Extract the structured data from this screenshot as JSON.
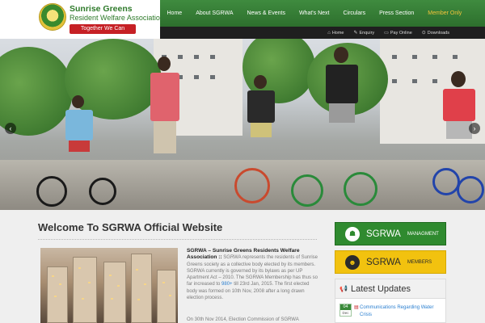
{
  "logo": {
    "title": "Sunrise Greens",
    "subtitle": "Resident Welfare Association",
    "tagline": "Together We Can"
  },
  "nav": {
    "items": [
      {
        "label": "Home"
      },
      {
        "label": "About SGRWA"
      },
      {
        "label": "News & Events"
      },
      {
        "label": "What's Next"
      },
      {
        "label": "Circulars"
      },
      {
        "label": "Press Section"
      },
      {
        "label": "Member Only"
      }
    ],
    "highlight_color": "#f3c33a"
  },
  "util": {
    "items": [
      {
        "label": "Home",
        "icon": "home-icon"
      },
      {
        "label": "Enquiry",
        "icon": "pencil-icon"
      },
      {
        "label": "Pay Online",
        "icon": "card-icon"
      },
      {
        "label": "Downloads",
        "icon": "download-icon"
      }
    ]
  },
  "welcome": {
    "heading": "Welcome To SGRWA Official Website"
  },
  "intro": {
    "title": "SGRWA – Sunrise Greens Residents Welfare Association ::",
    "text_a": " SGRWA represents the residents of Sunrise Greens society as a collective body elected by its members. SGRWA currently is governed by its bylaws as per UP Apartment Act – 2010. The SGRWA Membership has thus so far increased to ",
    "highlight": "980+",
    "text_b": " till 23rd Jan, 2015. The first elected body was formed on 10th Nov, 2008 after a long drawn election process.",
    "text_c": "On 30th Nov 2014, Election Commission of SGRWA"
  },
  "sidebar": {
    "management": {
      "big": "SGRWA",
      "small": "MANAGMENT"
    },
    "members": {
      "big": "SGRWA",
      "small": "MEMBERS"
    }
  },
  "updates": {
    "title": "Latest Updates",
    "items": [
      {
        "day": "04",
        "month": "Dec",
        "text": "Communications Regarding Water Crisis"
      }
    ]
  },
  "colors": {
    "brand_green": "#2f8a2f",
    "accent_yellow": "#f2c20f",
    "accent_red": "#c62025",
    "link_blue": "#2a7fd0"
  }
}
